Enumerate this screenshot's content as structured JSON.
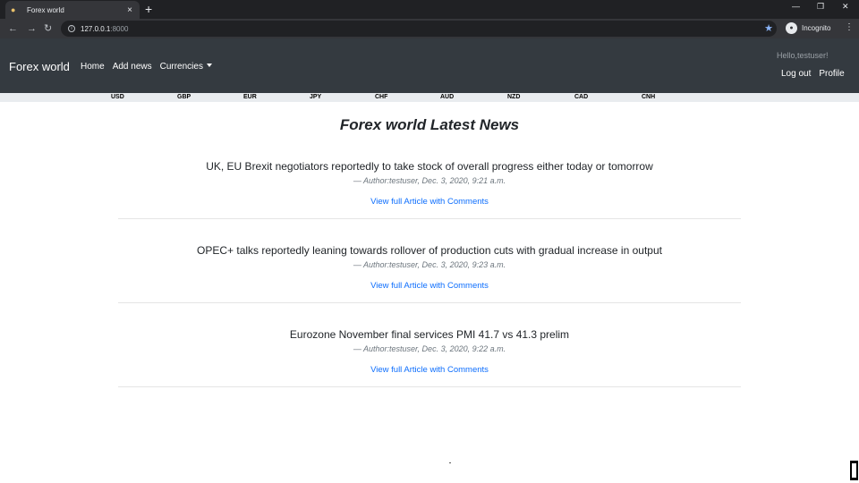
{
  "browser": {
    "tab_title": "Forex world",
    "url_host": "127.0.0.1",
    "url_port": ":8000",
    "incognito_label": "Incognito"
  },
  "navbar": {
    "brand": "Forex world",
    "links": [
      "Home",
      "Add news",
      "Currencies"
    ],
    "greeting": "Hello,testuser!",
    "logout": "Log out",
    "profile": "Profile"
  },
  "currencies": [
    "USD",
    "GBP",
    "EUR",
    "JPY",
    "CHF",
    "AUD",
    "NZD",
    "CAD",
    "CNH"
  ],
  "page_title": "Forex world Latest News",
  "articles": [
    {
      "headline": "UK, EU Brexit negotiators reportedly to take stock of overall progress either today or tomorrow",
      "byline": "— Author:testuser, Dec. 3, 2020, 9:21 a.m.",
      "link": "View full Article with Comments"
    },
    {
      "headline": "OPEC+ talks reportedly leaning towards rollover of production cuts with gradual increase in output",
      "byline": "— Author:testuser, Dec. 3, 2020, 9:23 a.m.",
      "link": "View full Article with Comments"
    },
    {
      "headline": "Eurozone November final services PMI 41.7 vs 41.3 prelim",
      "byline": "— Author:testuser, Dec. 3, 2020, 9:22 a.m.",
      "link": "View full Article with Comments"
    }
  ]
}
